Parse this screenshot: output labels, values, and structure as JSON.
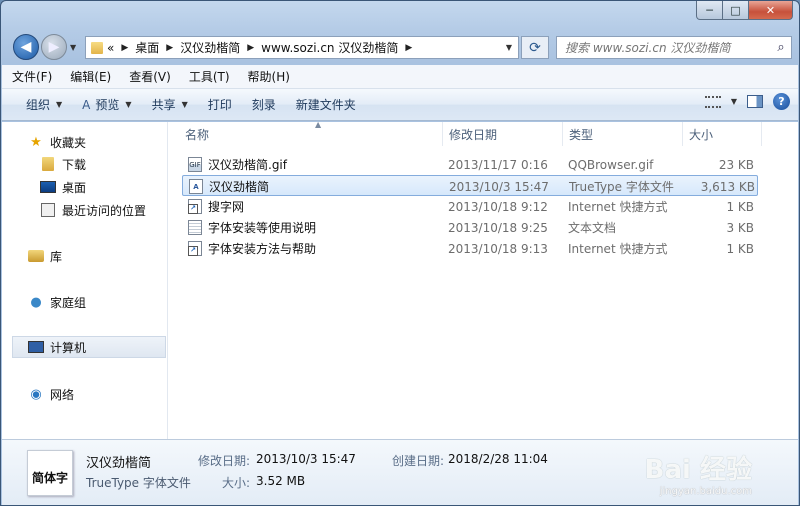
{
  "window": {
    "caption": {
      "minimize": "─",
      "maximize": "□",
      "close": "✕"
    }
  },
  "nav": {
    "back_glyph": "◀",
    "forward_glyph": "▶",
    "address": {
      "prefix": "«",
      "crumbs": [
        "桌面",
        "汉仪劲楷简",
        "www.sozi.cn 汉仪劲楷简"
      ]
    },
    "refresh_glyph": "⟳",
    "search_placeholder": "搜索 www.sozi.cn 汉仪劲楷简"
  },
  "menu": [
    "文件(F)",
    "编辑(E)",
    "查看(V)",
    "工具(T)",
    "帮助(H)"
  ],
  "toolbar": {
    "organize": "组织",
    "preview": "预览",
    "share": "共享",
    "print": "打印",
    "burn": "刻录",
    "new_folder": "新建文件夹",
    "help": "?"
  },
  "sidebar": {
    "favorites": "收藏夹",
    "downloads": "下载",
    "desktop": "桌面",
    "recent": "最近访问的位置",
    "libraries": "库",
    "homegroup": "家庭组",
    "computer": "计算机",
    "network": "网络"
  },
  "columns": {
    "name": "名称",
    "date": "修改日期",
    "type": "类型",
    "size": "大小"
  },
  "files": [
    {
      "icon": "gif-file-icon",
      "name": "汉仪劲楷简.gif",
      "date": "2013/11/17 0:16",
      "type": "QQBrowser.gif",
      "size": "23 KB"
    },
    {
      "icon": "font-file-icon",
      "name": "汉仪劲楷简",
      "date": "2013/10/3 15:47",
      "type": "TrueType 字体文件",
      "size": "3,613 KB",
      "selected": true
    },
    {
      "icon": "shortcut-icon",
      "name": "搜字网",
      "date": "2013/10/18 9:12",
      "type": "Internet 快捷方式",
      "size": "1 KB"
    },
    {
      "icon": "text-file-icon",
      "name": "字体安装等使用说明",
      "date": "2013/10/18 9:25",
      "type": "文本文档",
      "size": "3 KB"
    },
    {
      "icon": "shortcut-icon",
      "name": "字体安装方法与帮助",
      "date": "2013/10/18 9:13",
      "type": "Internet 快捷方式",
      "size": "1 KB"
    }
  ],
  "details": {
    "thumb_text": "简体字",
    "name": "汉仪劲楷简",
    "type": "TrueType 字体文件",
    "modified_label": "修改日期:",
    "modified_value": "2013/10/3 15:47",
    "created_label": "创建日期:",
    "created_value": "2018/2/28 11:04",
    "size_label": "大小:",
    "size_value": "3.52 MB"
  },
  "watermark": {
    "main": "Bai 经验",
    "sub": "jingyan.baidu.com"
  }
}
